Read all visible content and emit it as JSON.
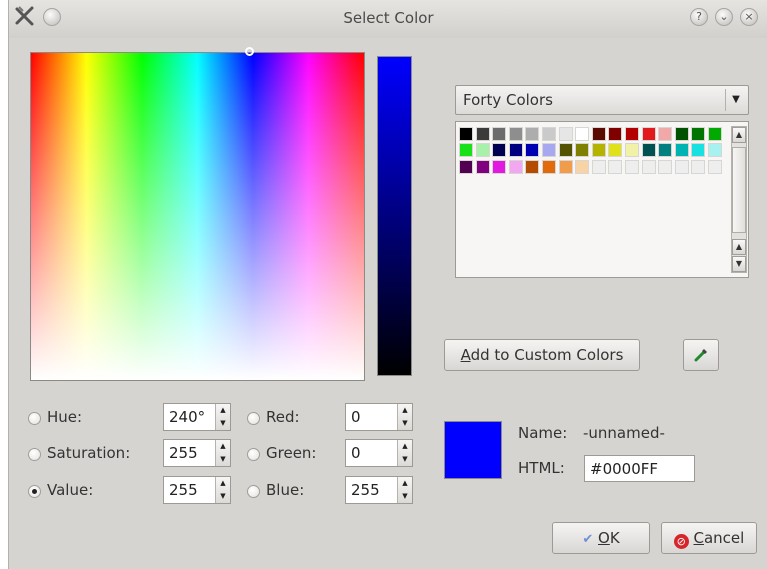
{
  "window": {
    "title": "Select Color",
    "icons": [
      "close-x-icon",
      "restore-circle-icon",
      "help-icon",
      "minimize-icon",
      "close-icon"
    ]
  },
  "picker": {
    "hue_cursor_present": true
  },
  "palette": {
    "preset_label": "Forty Colors",
    "rows": [
      [
        "#000000",
        "#3b3b3b",
        "#6c6c6c",
        "#8e8e8e",
        "#adadad",
        "#cacaca",
        "#e6e6e6",
        "#ffffff",
        "#5a0a00",
        "#800000",
        "#b30000",
        "#e11b1b",
        "#f1a8a8",
        "#005200",
        "#007500",
        "#00aa00"
      ],
      [
        "#19e119",
        "#a8f1a8",
        "#000052",
        "#000080",
        "#0000b3",
        "#a8a8f1",
        "#525200",
        "#808000",
        "#b3b300",
        "#e1e119",
        "#f1f1a8",
        "#005252",
        "#008080",
        "#00b3b3",
        "#19e1e1",
        "#a8f1f1"
      ],
      [
        "#520052",
        "#800080",
        "#e119e1",
        "#f1a8f1",
        "#b34b00",
        "#e16a0a",
        "#f19c4a",
        "#f7d3a6",
        "#eeeeee",
        "#eeeeee",
        "#eeeeee",
        "#eeeeee",
        "#eeeeee",
        "#eeeeee",
        "#eeeeee",
        "#eeeeee"
      ]
    ]
  },
  "buttons": {
    "add_custom_prefix": "A",
    "add_custom_rest": "dd to Custom Colors",
    "ok_prefix": "O",
    "ok_rest": "K",
    "cancel_prefix": "C",
    "cancel_rest": "ancel"
  },
  "fields": {
    "hue_label": "Hue:",
    "hue_value": "240°",
    "saturation_label": "Saturation:",
    "saturation_value": "255",
    "value_label": "Value:",
    "value_value": "255",
    "red_label": "Red:",
    "red_value": "0",
    "green_label": "Green:",
    "green_value": "0",
    "blue_label": "Blue:",
    "blue_value": "255",
    "selected_mode": "value"
  },
  "color_info": {
    "preview_color": "#0000FF",
    "name_label": "Name:",
    "name_value": "-unnamed-",
    "html_label": "HTML:",
    "html_value": "#0000FF"
  }
}
